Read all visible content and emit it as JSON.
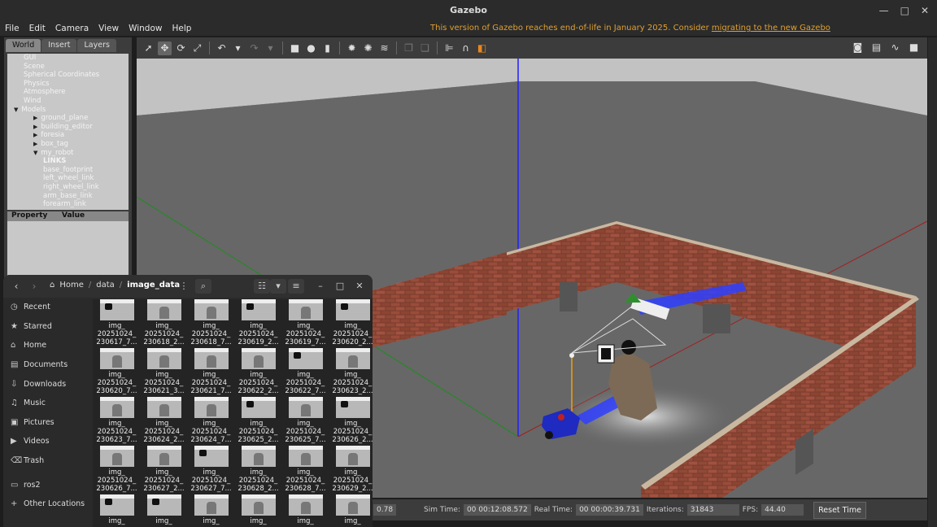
{
  "window": {
    "title": "Gazebo"
  },
  "menu": [
    "File",
    "Edit",
    "Camera",
    "View",
    "Window",
    "Help"
  ],
  "notice": {
    "text": "This version of Gazebo reaches end-of-life in January 2025. Consider ",
    "link": "migrating to the new Gazebo"
  },
  "left_panel": {
    "tabs": [
      "World",
      "Insert",
      "Layers"
    ],
    "tree": [
      {
        "label": "GUI",
        "indent": 1,
        "arrow": ""
      },
      {
        "label": "Scene",
        "indent": 1,
        "arrow": ""
      },
      {
        "label": "Spherical Coordinates",
        "indent": 1,
        "arrow": ""
      },
      {
        "label": "Physics",
        "indent": 1,
        "arrow": ""
      },
      {
        "label": "Atmosphere",
        "indent": 1,
        "arrow": ""
      },
      {
        "label": "Wind",
        "indent": 1,
        "arrow": ""
      },
      {
        "label": "Models",
        "indent": 0,
        "arrow": "down"
      },
      {
        "label": "ground_plane",
        "indent": 2,
        "arrow": "right"
      },
      {
        "label": "building_editor",
        "indent": 2,
        "arrow": "right"
      },
      {
        "label": "foresia",
        "indent": 2,
        "arrow": "right"
      },
      {
        "label": "box_tag",
        "indent": 2,
        "arrow": "right"
      },
      {
        "label": "my_robot",
        "indent": 2,
        "arrow": "down"
      },
      {
        "label": "LINKS",
        "indent": 3,
        "arrow": "",
        "bold": true
      },
      {
        "label": "base_footprint",
        "indent": 3,
        "arrow": ""
      },
      {
        "label": "left_wheel_link",
        "indent": 3,
        "arrow": ""
      },
      {
        "label": "right_wheel_link",
        "indent": 3,
        "arrow": ""
      },
      {
        "label": "arm_base_link",
        "indent": 3,
        "arrow": ""
      },
      {
        "label": "forearm_link",
        "indent": 3,
        "arrow": ""
      }
    ],
    "property_header": "Property",
    "value_header": "Value"
  },
  "status": {
    "rt_factor": "0.78",
    "sim_time_label": "Sim Time:",
    "sim_time": "00 00:12:08.572",
    "real_time_label": "Real Time:",
    "real_time": "00 00:00:39.731",
    "iterations_label": "Iterations:",
    "iterations": "31843",
    "fps_label": "FPS:",
    "fps": "44.40",
    "reset_label": "Reset Time"
  },
  "files": {
    "breadcrumb": {
      "home": "Home",
      "data": "data",
      "current": "image_data"
    },
    "sidebar": [
      {
        "label": "Recent",
        "icon": "clock-icon"
      },
      {
        "label": "Starred",
        "icon": "star-icon"
      },
      {
        "label": "Home",
        "icon": "home-icon"
      },
      {
        "label": "Documents",
        "icon": "document-icon"
      },
      {
        "label": "Downloads",
        "icon": "download-icon"
      },
      {
        "label": "Music",
        "icon": "music-icon"
      },
      {
        "label": "Pictures",
        "icon": "picture-icon"
      },
      {
        "label": "Videos",
        "icon": "video-icon"
      },
      {
        "label": "Trash",
        "icon": "trash-icon"
      },
      {
        "label": "ros2",
        "icon": "folder-icon"
      },
      {
        "label": "Other Locations",
        "icon": "plus-icon"
      }
    ],
    "items": [
      {
        "l1": "img_",
        "l2": "20251024_",
        "l3": "230617_7..."
      },
      {
        "l1": "img_",
        "l2": "20251024_",
        "l3": "230618_2..."
      },
      {
        "l1": "img_",
        "l2": "20251024_",
        "l3": "230618_7..."
      },
      {
        "l1": "img_",
        "l2": "20251024_",
        "l3": "230619_2..."
      },
      {
        "l1": "img_",
        "l2": "20251024_",
        "l3": "230619_7..."
      },
      {
        "l1": "img_",
        "l2": "20251024_",
        "l3": "230620_2..."
      },
      {
        "l1": "img_",
        "l2": "20251024_",
        "l3": "230620_7..."
      },
      {
        "l1": "img_",
        "l2": "20251024_",
        "l3": "230621_3..."
      },
      {
        "l1": "img_",
        "l2": "20251024_",
        "l3": "230621_7..."
      },
      {
        "l1": "img_",
        "l2": "20251024_",
        "l3": "230622_2..."
      },
      {
        "l1": "img_",
        "l2": "20251024_",
        "l3": "230622_7..."
      },
      {
        "l1": "img_",
        "l2": "20251024_",
        "l3": "230623_2..."
      },
      {
        "l1": "img_",
        "l2": "20251024_",
        "l3": "230623_7..."
      },
      {
        "l1": "img_",
        "l2": "20251024_",
        "l3": "230624_2..."
      },
      {
        "l1": "img_",
        "l2": "20251024_",
        "l3": "230624_7..."
      },
      {
        "l1": "img_",
        "l2": "20251024_",
        "l3": "230625_2..."
      },
      {
        "l1": "img_",
        "l2": "20251024_",
        "l3": "230625_7..."
      },
      {
        "l1": "img_",
        "l2": "20251024_",
        "l3": "230626_2..."
      },
      {
        "l1": "img_",
        "l2": "20251024_",
        "l3": "230626_7..."
      },
      {
        "l1": "img_",
        "l2": "20251024_",
        "l3": "230627_2..."
      },
      {
        "l1": "img_",
        "l2": "20251024_",
        "l3": "230627_7..."
      },
      {
        "l1": "img_",
        "l2": "20251024_",
        "l3": "230628_2..."
      },
      {
        "l1": "img_",
        "l2": "20251024_",
        "l3": "230628_7..."
      },
      {
        "l1": "img_",
        "l2": "20251024_",
        "l3": "230629_2..."
      },
      {
        "l1": "img_",
        "l2": "",
        "l3": ""
      },
      {
        "l1": "img_",
        "l2": "",
        "l3": ""
      },
      {
        "l1": "img_",
        "l2": "",
        "l3": ""
      },
      {
        "l1": "img_",
        "l2": "",
        "l3": ""
      },
      {
        "l1": "img_",
        "l2": "",
        "l3": ""
      },
      {
        "l1": "img_",
        "l2": "",
        "l3": ""
      }
    ]
  }
}
